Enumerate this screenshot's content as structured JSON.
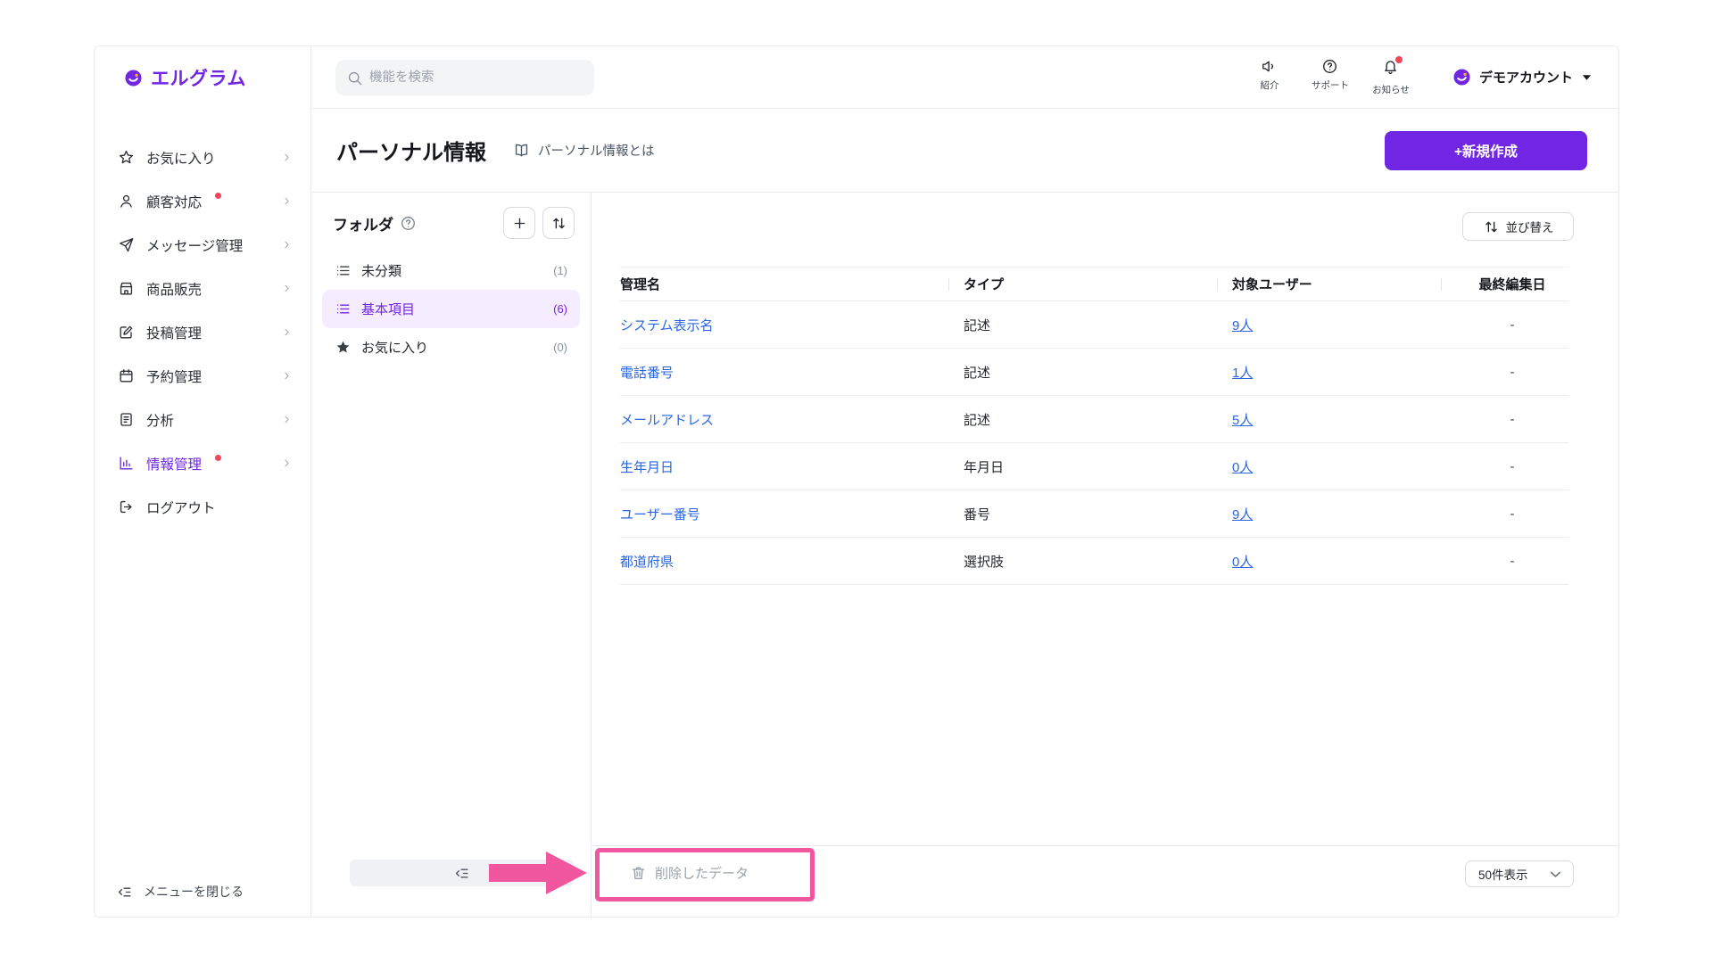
{
  "brand": {
    "name": "エルグラム"
  },
  "header": {
    "search_placeholder": "機能を検索",
    "actions": [
      {
        "label": "紹介"
      },
      {
        "label": "サポート"
      },
      {
        "label": "お知らせ",
        "has_badge": true
      }
    ],
    "account_name": "デモアカウント"
  },
  "sidebar": {
    "items": [
      {
        "label": "お気に入り"
      },
      {
        "label": "顧客対応",
        "dot": true
      },
      {
        "label": "メッセージ管理"
      },
      {
        "label": "商品販売"
      },
      {
        "label": "投稿管理"
      },
      {
        "label": "予約管理"
      },
      {
        "label": "分析"
      },
      {
        "label": "情報管理",
        "dot": true,
        "active": true
      },
      {
        "label": "ログアウト"
      }
    ],
    "close_menu": "メニューを閉じる"
  },
  "page": {
    "title": "パーソナル情報",
    "help_link": "パーソナル情報とは",
    "create_button": "+新規作成"
  },
  "folders": {
    "title": "フォルダ",
    "items": [
      {
        "label": "未分類",
        "count": "(1)"
      },
      {
        "label": "基本項目",
        "count": "(6)",
        "active": true
      },
      {
        "label": "お気に入り",
        "count": "(0)"
      }
    ]
  },
  "table": {
    "sort_button": "並び替え",
    "headers": [
      "管理名",
      "タイプ",
      "対象ユーザー",
      "最終編集日"
    ],
    "rows": [
      {
        "name": "システム表示名",
        "type": "記述",
        "users": "9人",
        "edited": "-"
      },
      {
        "name": "電話番号",
        "type": "記述",
        "users": "1人",
        "edited": "-"
      },
      {
        "name": "メールアドレス",
        "type": "記述",
        "users": "5人",
        "edited": "-"
      },
      {
        "name": "生年月日",
        "type": "年月日",
        "users": "0人",
        "edited": "-"
      },
      {
        "name": "ユーザー番号",
        "type": "番号",
        "users": "9人",
        "edited": "-"
      },
      {
        "name": "都道府県",
        "type": "選択肢",
        "users": "0人",
        "edited": "-"
      }
    ]
  },
  "footer": {
    "deleted_data": "削除したデータ",
    "page_size": "50件表示"
  },
  "colors": {
    "accent": "#7126E3",
    "link": "#2B66DE",
    "annotation": "#F0579E",
    "alert_dot": "#F2455A"
  }
}
